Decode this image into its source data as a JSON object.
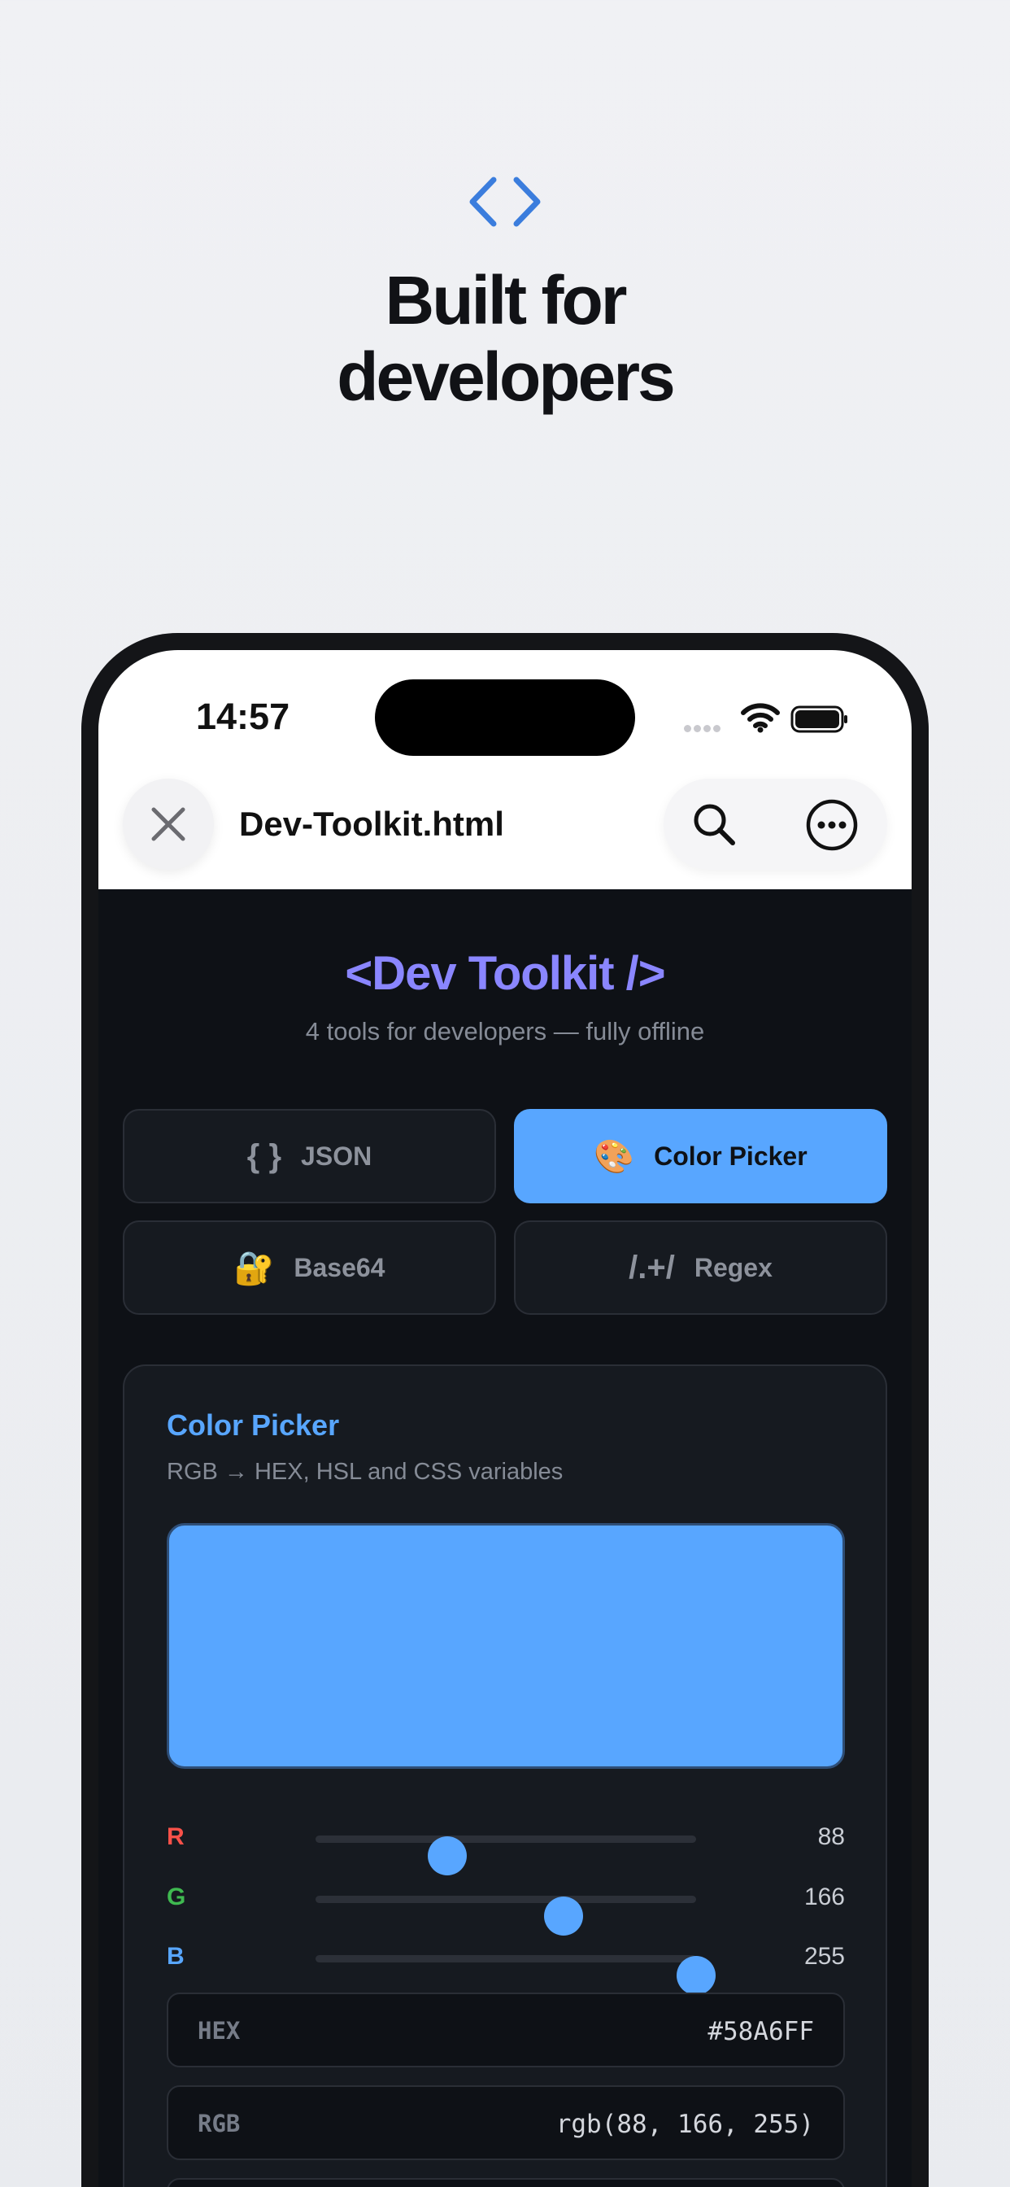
{
  "hero": {
    "icon": "code-brackets-icon",
    "title_line1": "Built for",
    "title_line2": "developers"
  },
  "status_bar": {
    "time": "14:57",
    "icons": [
      "signal-dots-icon",
      "wifi-icon",
      "battery-icon"
    ]
  },
  "browser_nav": {
    "close_icon": "close-icon",
    "title": "Dev-Toolkit.html",
    "search_icon": "search-icon",
    "more_icon": "more-icon"
  },
  "app": {
    "title": "<Dev Toolkit />",
    "subtitle": "4 tools for developers — fully offline",
    "tabs": [
      {
        "icon": "{ }",
        "label": "JSON",
        "active": false
      },
      {
        "icon": "🎨",
        "label": "Color Picker",
        "active": true
      },
      {
        "icon": "🔐",
        "label": "Base64",
        "active": false
      },
      {
        "icon": "/.+/",
        "label": "Regex",
        "active": false
      }
    ]
  },
  "color_picker": {
    "title": "Color Picker",
    "description": "RGB → HEX, HSL and CSS variables",
    "swatch_color": "#58A6FF",
    "sliders": [
      {
        "label": "R",
        "value": 88,
        "max": 255,
        "color": "#f85149"
      },
      {
        "label": "G",
        "value": 166,
        "max": 255,
        "color": "#3fb950"
      },
      {
        "label": "B",
        "value": 255,
        "max": 255,
        "color": "#58a6ff"
      }
    ],
    "outputs": [
      {
        "label": "HEX",
        "value": "#58A6FF"
      },
      {
        "label": "RGB",
        "value": "rgb(88, 166, 255)"
      }
    ]
  },
  "colors": {
    "accent": "#58a6ff",
    "title_purple": "#8a86ff",
    "background_dark": "#0e1116"
  }
}
